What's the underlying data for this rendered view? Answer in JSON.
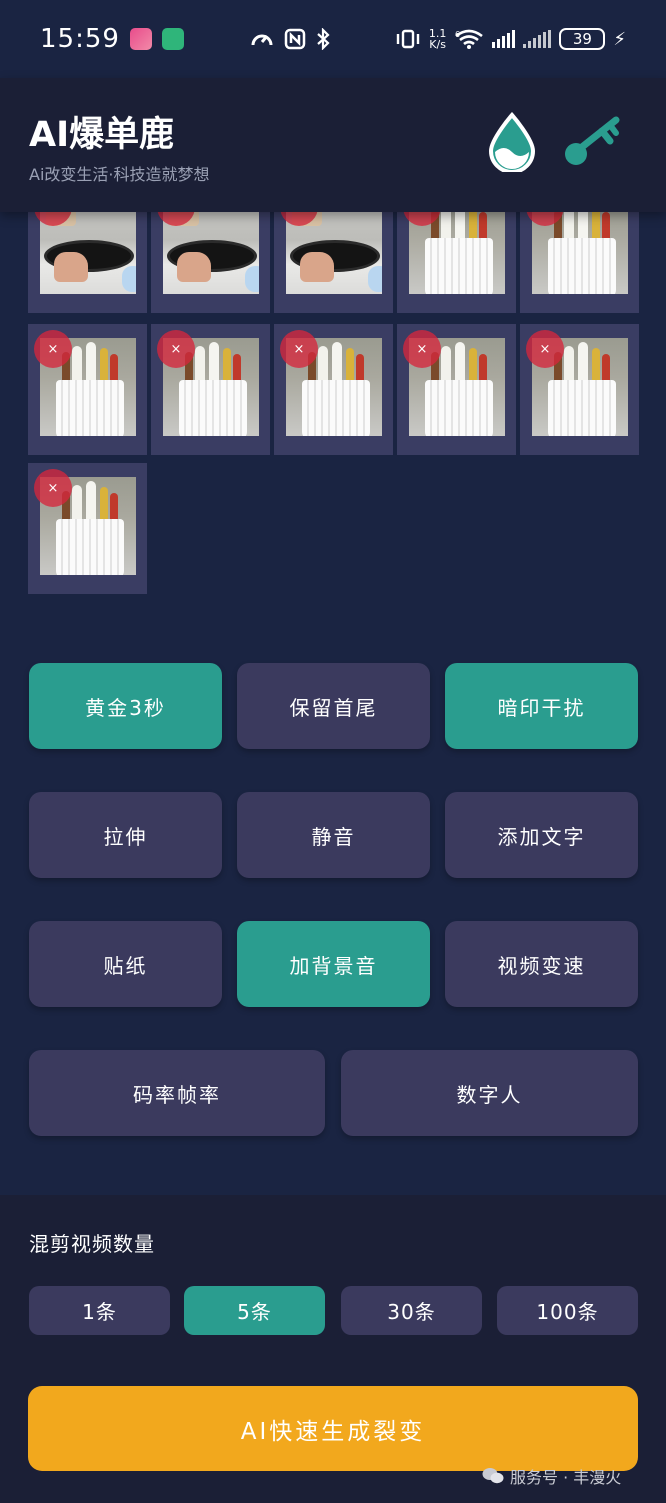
{
  "status_bar": {
    "time": "15:59",
    "net_speed_top": "1.1",
    "net_speed_unit": "K/s",
    "wifi_label": "6",
    "battery": "39",
    "icons": [
      "app-badge-icon",
      "mi-home-icon",
      "speed-meter-icon",
      "nfc-icon",
      "bluetooth-icon",
      "vibrate-icon",
      "wifi-icon",
      "signal-icon",
      "charging-icon"
    ]
  },
  "header": {
    "title": "AI爆单鹿",
    "subtitle": "Ai改变生活·科技造就梦想",
    "accent_color": "#2a9d8f"
  },
  "thumbnails": [
    {
      "kind": "pan",
      "delete": "×"
    },
    {
      "kind": "pan",
      "delete": "×"
    },
    {
      "kind": "pan",
      "delete": "×"
    },
    {
      "kind": "cup",
      "delete": "×"
    },
    {
      "kind": "cup",
      "delete": "×"
    },
    {
      "kind": "cup",
      "delete": "×"
    },
    {
      "kind": "cup",
      "delete": "×"
    },
    {
      "kind": "cup",
      "delete": "×"
    },
    {
      "kind": "cup",
      "delete": "×"
    },
    {
      "kind": "cup",
      "delete": "×"
    },
    {
      "kind": "cup",
      "delete": "×"
    }
  ],
  "options": [
    {
      "label": "黄金3秒",
      "active": true
    },
    {
      "label": "保留首尾",
      "active": false
    },
    {
      "label": "暗印干扰",
      "active": true
    },
    {
      "label": "拉伸",
      "active": false
    },
    {
      "label": "静音",
      "active": false
    },
    {
      "label": "添加文字",
      "active": false
    },
    {
      "label": "贴纸",
      "active": false
    },
    {
      "label": "加背景音",
      "active": true
    },
    {
      "label": "视频变速",
      "active": false
    },
    {
      "label": "码率帧率",
      "active": false
    },
    {
      "label": "数字人",
      "active": false
    }
  ],
  "count_section": {
    "label": "混剪视频数量",
    "options": [
      {
        "label": "1条",
        "active": false
      },
      {
        "label": "5条",
        "active": true
      },
      {
        "label": "30条",
        "active": false
      },
      {
        "label": "100条",
        "active": false
      }
    ]
  },
  "generate_button": "AI快速生成裂变",
  "watermark": "服务号 · 丰漫火",
  "colors": {
    "background": "#1a2442",
    "panel": "#1b1f36",
    "button": "#3b3a5e",
    "active": "#2a9d8f",
    "generate": "#f2a81d",
    "delete": "#d6263c"
  }
}
